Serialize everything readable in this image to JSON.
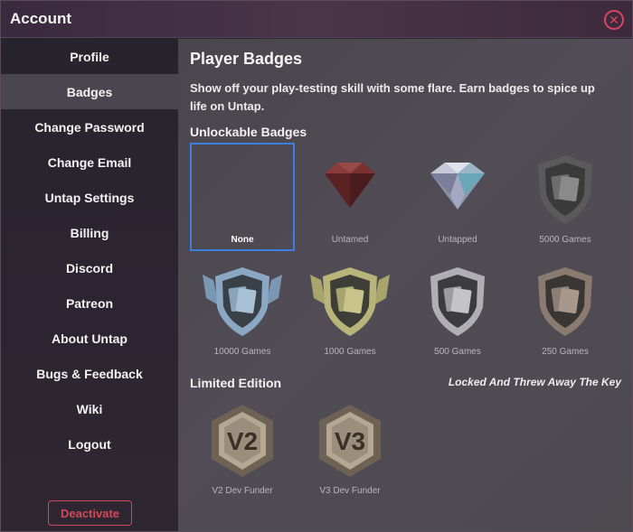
{
  "window": {
    "title": "Account"
  },
  "sidebar": {
    "items": [
      {
        "label": "Profile"
      },
      {
        "label": "Badges"
      },
      {
        "label": "Change Password"
      },
      {
        "label": "Change Email"
      },
      {
        "label": "Untap Settings"
      },
      {
        "label": "Billing"
      },
      {
        "label": "Discord"
      },
      {
        "label": "Patreon"
      },
      {
        "label": "About Untap"
      },
      {
        "label": "Bugs & Feedback"
      },
      {
        "label": "Wiki"
      },
      {
        "label": "Logout"
      }
    ],
    "active_item": "Badges",
    "deactivate_label": "Deactivate"
  },
  "main": {
    "heading": "Player Badges",
    "description": "Show off your play-testing skill with some flare. Earn badges to spice up life on Untap.",
    "unlockable": {
      "title": "Unlockable Badges",
      "selected": "None",
      "badges": [
        {
          "label": "None",
          "icon": "none"
        },
        {
          "label": "Untamed",
          "icon": "red-gem-icon"
        },
        {
          "label": "Untapped",
          "icon": "diamond-gem-icon"
        },
        {
          "label": "5000 Games",
          "icon": "dark-shield-cards-icon"
        },
        {
          "label": "10000 Games",
          "icon": "blue-winged-shield-cards-icon"
        },
        {
          "label": "1000 Games",
          "icon": "gold-winged-shield-cards-icon"
        },
        {
          "label": "500 Games",
          "icon": "silver-shield-cards-icon"
        },
        {
          "label": "250 Games",
          "icon": "bronze-shield-cards-icon"
        }
      ]
    },
    "limited": {
      "title": "Limited Edition",
      "note": "Locked And Threw Away The Key",
      "badges": [
        {
          "label": "V2 Dev Funder",
          "icon": "v2-hexagon-badge-icon",
          "text": "V2"
        },
        {
          "label": "V3 Dev Funder",
          "icon": "v3-hexagon-badge-icon",
          "text": "V3"
        }
      ]
    }
  },
  "colors": {
    "accent_blue": "#3d7fe0",
    "danger_red": "#d04a5a"
  }
}
